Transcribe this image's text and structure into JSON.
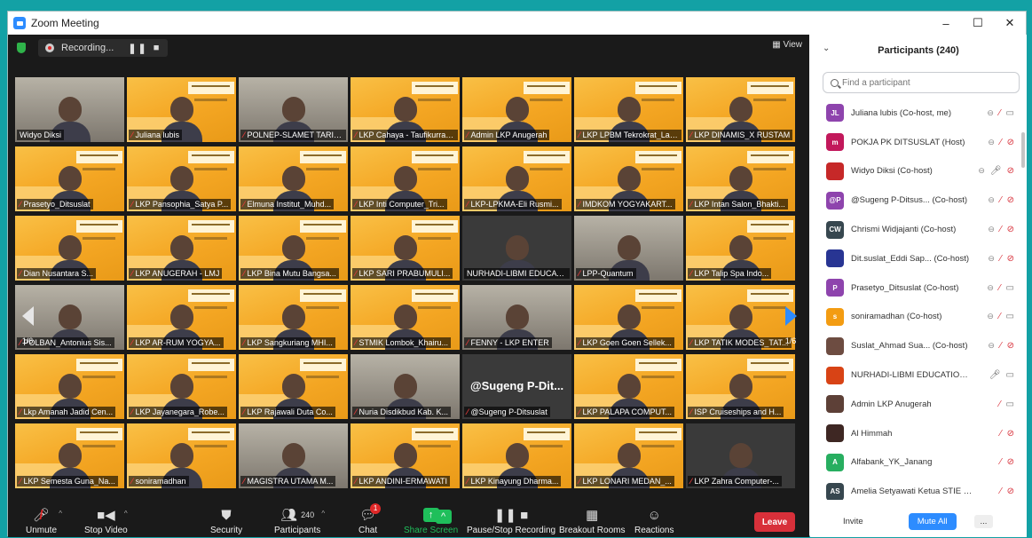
{
  "window": {
    "title": "Zoom Meeting",
    "minimize": "–",
    "maximize": "☐",
    "close": "✕"
  },
  "recording": {
    "label": "Recording...",
    "pause": "❚❚",
    "stop": "■"
  },
  "view_label": "View",
  "pages": {
    "left": "1/6",
    "right": "1/6"
  },
  "tiles": [
    {
      "name": "Widyo Diksi",
      "muted": false,
      "kind": "cam"
    },
    {
      "name": "Juliana lubis",
      "muted": true,
      "kind": "slide"
    },
    {
      "name": "POLNEP-SLAMET TARIGAN",
      "muted": true,
      "kind": "cam"
    },
    {
      "name": "LKP Cahaya - Taufikurrahman",
      "muted": true,
      "kind": "slide"
    },
    {
      "name": "Admin LKP Anugerah",
      "muted": true,
      "kind": "slide"
    },
    {
      "name": "LKP LPBM Tekrokrat_Lampung",
      "muted": true,
      "kind": "slide"
    },
    {
      "name": "LKP DINAMIS_X RUSTAM",
      "muted": true,
      "kind": "slide"
    },
    {
      "name": "Prasetyo_Ditsuslat",
      "muted": true,
      "kind": "slide"
    },
    {
      "name": "LKP Pansophia_Satya P...",
      "muted": true,
      "kind": "slide"
    },
    {
      "name": "Elmuna Institut_Muhd...",
      "muted": true,
      "kind": "slide"
    },
    {
      "name": "LKP Inti Computer_Tri...",
      "muted": true,
      "kind": "slide"
    },
    {
      "name": "LKP-LPKMA-Eli Rusmi...",
      "muted": true,
      "kind": "slide"
    },
    {
      "name": "IMDKOM YOGYAKART...",
      "muted": true,
      "kind": "slide"
    },
    {
      "name": "LKP Intan Salon_Bhakti...",
      "muted": true,
      "kind": "slide"
    },
    {
      "name": "Dian Nusantara S...",
      "muted": true,
      "kind": "slide"
    },
    {
      "name": "LKP ANUGERAH - LMJ",
      "muted": true,
      "kind": "slide"
    },
    {
      "name": "LKP Bina Mutu Bangsa...",
      "muted": true,
      "kind": "slide"
    },
    {
      "name": "LKP SARI PRABUMULI...",
      "muted": true,
      "kind": "slide"
    },
    {
      "name": "NURHADI-LIBMI EDUCATI...",
      "muted": false,
      "kind": "dark"
    },
    {
      "name": "LPP-Quantum",
      "muted": true,
      "kind": "cam"
    },
    {
      "name": "LKP Talip Spa Indo...",
      "muted": true,
      "kind": "slide"
    },
    {
      "name": "POLBAN_Antonius Sis...",
      "muted": true,
      "kind": "cam"
    },
    {
      "name": "LKP AR-RUM YOGYA...",
      "muted": true,
      "kind": "slide"
    },
    {
      "name": "LKP Sangkuriang MHI...",
      "muted": true,
      "kind": "slide"
    },
    {
      "name": "STMIK Lombok_Khairu...",
      "muted": true,
      "kind": "slide"
    },
    {
      "name": "FENNY - LKP ENTER",
      "muted": true,
      "kind": "cam"
    },
    {
      "name": "LKP Goen Goen Sellek...",
      "muted": true,
      "kind": "slide"
    },
    {
      "name": "LKP TATIK MODES_TAT...",
      "muted": true,
      "kind": "slide"
    },
    {
      "name": "Lkp Amanah Jadid Cen...",
      "muted": true,
      "kind": "slide"
    },
    {
      "name": "LKP Jayanegara_Robe...",
      "muted": true,
      "kind": "slide"
    },
    {
      "name": "LKP Rajawali Duta Co...",
      "muted": true,
      "kind": "slide"
    },
    {
      "name": "Nuria Disdikbud Kab. K...",
      "muted": true,
      "kind": "cam"
    },
    {
      "name": "@Sugeng P-Ditsuslat",
      "muted": true,
      "kind": "dark",
      "big": "@Sugeng P-Dit..."
    },
    {
      "name": "LKP PALAPA COMPUT...",
      "muted": true,
      "kind": "slide"
    },
    {
      "name": "ISP Cruiseships and H...",
      "muted": true,
      "kind": "slide"
    },
    {
      "name": "LKP Semesta Guna_Na...",
      "muted": true,
      "kind": "slide"
    },
    {
      "name": "soniramadhan",
      "muted": true,
      "kind": "slide"
    },
    {
      "name": "MAGISTRA UTAMA M...",
      "muted": true,
      "kind": "cam"
    },
    {
      "name": "LKP ANDINI-ERMAWATI",
      "muted": true,
      "kind": "slide"
    },
    {
      "name": "LKP Kinayung Dharma...",
      "muted": true,
      "kind": "slide"
    },
    {
      "name": "LKP LONARI MEDAN_...",
      "muted": true,
      "kind": "slide"
    },
    {
      "name": "LKP Zahra Computer-...",
      "muted": true,
      "kind": "dark"
    }
  ],
  "toolbar": {
    "unmute": "Unmute",
    "stop_video": "Stop Video",
    "security": "Security",
    "participants": "Participants",
    "participants_count": "240",
    "chat": "Chat",
    "chat_badge": "1",
    "share_screen": "Share Screen",
    "pause_recording": "Pause/Stop Recording",
    "breakout": "Breakout Rooms",
    "reactions": "Reactions",
    "leave": "Leave"
  },
  "panel": {
    "title": "Participants (240)",
    "search_placeholder": "Find a participant",
    "participants": [
      {
        "initials": "JL",
        "color": "#8e44ad",
        "name": "Juliana lubis (Co-host, me)",
        "mic": "off",
        "video": "on",
        "cc": true
      },
      {
        "initials": "m",
        "color": "#c2185b",
        "name": "POKJA PK DITSUSLAT (Host)",
        "mic": "off",
        "video": "off",
        "cc": true
      },
      {
        "initials": "",
        "color": "#c62828",
        "name": "Widyo Diksi (Co-host)",
        "mic": "on",
        "video": "off",
        "cc": true
      },
      {
        "initials": "@P",
        "color": "#8e44ad",
        "name": "@Sugeng P-Ditsus... (Co-host)",
        "mic": "off",
        "video": "off",
        "cc": true
      },
      {
        "initials": "CW",
        "color": "#37474f",
        "name": "Chrismi Widjajanti (Co-host)",
        "mic": "off",
        "video": "off",
        "cc": true
      },
      {
        "initials": "",
        "color": "#283593",
        "name": "Dit.suslat_Eddi Sap... (Co-host)",
        "mic": "off",
        "video": "off",
        "cc": true
      },
      {
        "initials": "P",
        "color": "#8e44ad",
        "name": "Prasetyo_Ditsuslat (Co-host)",
        "mic": "off",
        "video": "on",
        "cc": true
      },
      {
        "initials": "s",
        "color": "#f39c12",
        "name": "soniramadhan (Co-host)",
        "mic": "off",
        "video": "on",
        "cc": true
      },
      {
        "initials": "",
        "color": "#6d4c41",
        "name": "Suslat_Ahmad Sua... (Co-host)",
        "mic": "off",
        "video": "off",
        "cc": true
      },
      {
        "initials": "",
        "color": "#d84315",
        "name": "NURHADI-LIBMI EDUCATION CE...",
        "mic": "on",
        "video": "on",
        "cc": false
      },
      {
        "initials": "",
        "color": "#5d4037",
        "name": "Admin LKP Anugerah",
        "mic": "off",
        "video": "on",
        "cc": false
      },
      {
        "initials": "",
        "color": "#3e2723",
        "name": "Al Himmah",
        "mic": "off",
        "video": "off",
        "cc": false
      },
      {
        "initials": "A",
        "color": "#27ae60",
        "name": "Alfabank_YK_Janang",
        "mic": "off",
        "video": "off",
        "cc": false
      },
      {
        "initials": "AS",
        "color": "#37474f",
        "name": "Amelia Setyawati Ketua STIE Mal...",
        "mic": "off",
        "video": "off",
        "cc": false
      }
    ],
    "invite": "Invite",
    "mute_all": "Mute All",
    "more": "..."
  }
}
